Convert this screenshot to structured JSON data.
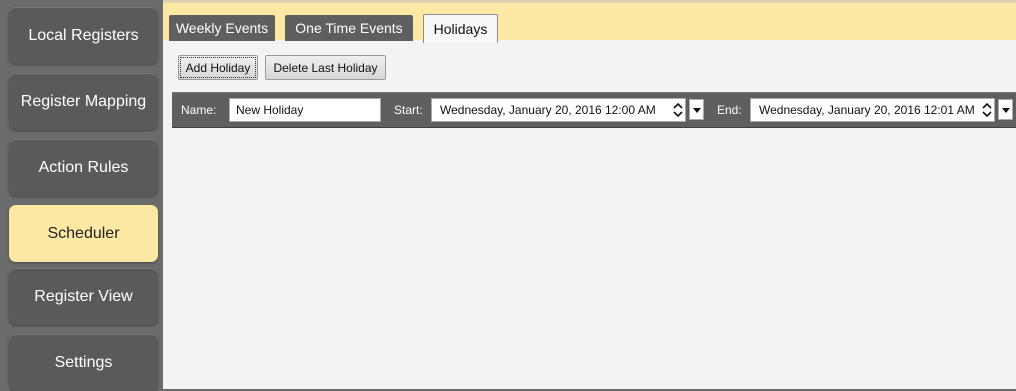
{
  "sidebar": {
    "items": [
      {
        "label": "Local Registers",
        "active": false
      },
      {
        "label": "Register Mapping",
        "active": false
      },
      {
        "label": "Action Rules",
        "active": false
      },
      {
        "label": "Scheduler",
        "active": true
      },
      {
        "label": "Register View",
        "active": false
      },
      {
        "label": "Settings",
        "active": false
      }
    ]
  },
  "tabs": [
    {
      "label": "Weekly Events",
      "active": false
    },
    {
      "label": "One Time Events",
      "active": false
    },
    {
      "label": "Holidays",
      "active": true
    }
  ],
  "toolbar": {
    "add_label": "Add Holiday",
    "delete_label": "Delete Last Holiday"
  },
  "holiday": {
    "name_label": "Name:",
    "name_value": "New Holiday",
    "start_label": "Start:",
    "start_value": "Wednesday, January 20, 2016 12:00 AM",
    "end_label": "End:",
    "end_value": "Wednesday, January 20, 2016 12:01 AM"
  },
  "colors": {
    "accent": "#fde9a3",
    "sidebar_button": "#5a5a5a",
    "content_bg": "#f3f3f3",
    "bar_bg": "#5f5f5f"
  },
  "icons": {
    "spinner": "updown-spinner-icon",
    "dropdown": "chevron-down-icon"
  }
}
